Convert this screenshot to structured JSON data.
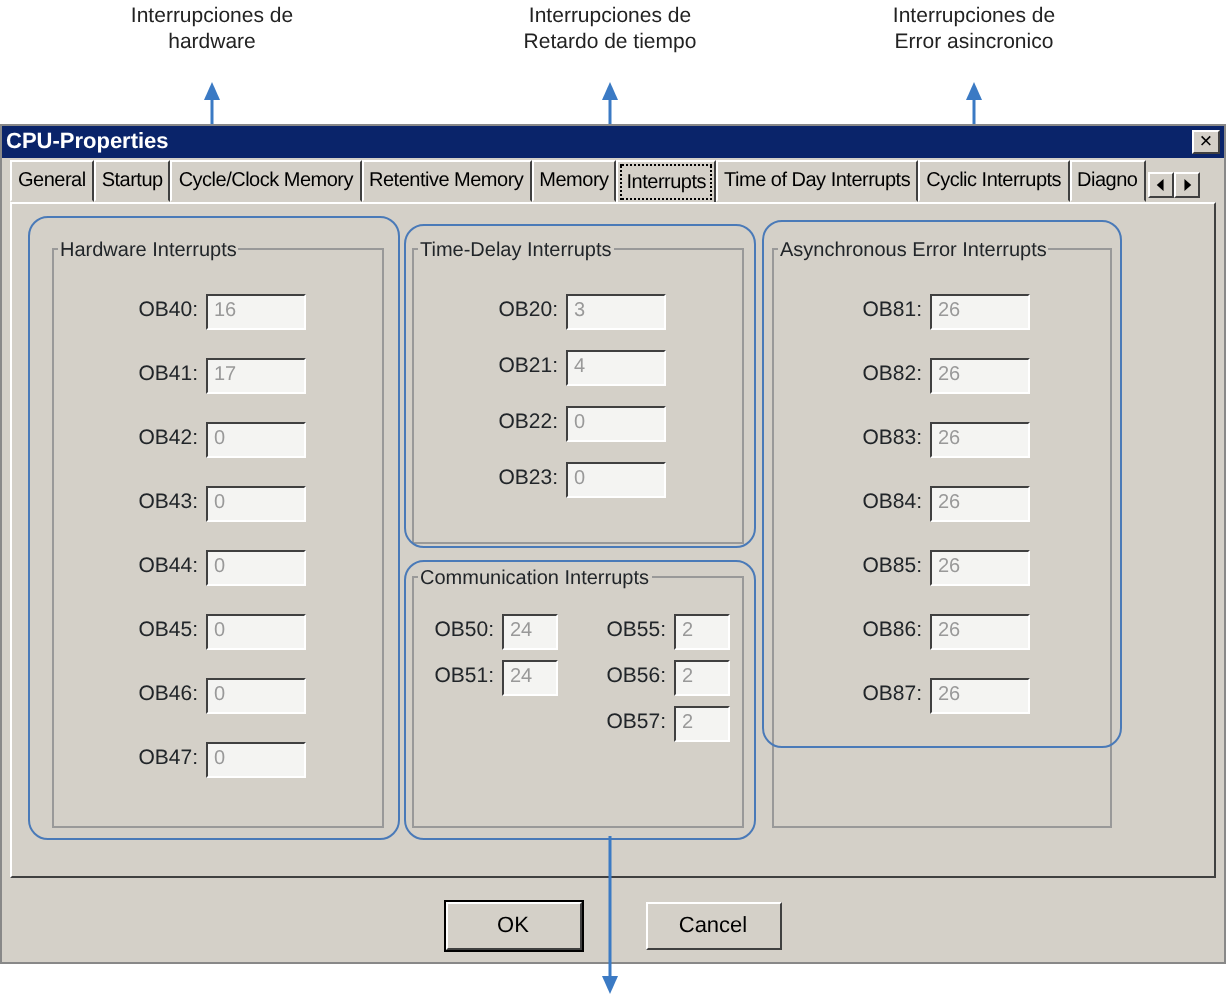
{
  "callouts": [
    {
      "kind": "up",
      "lines": [
        "Interrupciones de",
        "hardware"
      ]
    },
    {
      "kind": "up",
      "lines": [
        "Interrupciones de",
        "Retardo de tiempo"
      ]
    },
    {
      "kind": "up",
      "lines": [
        "Interrupciones de",
        "Error asincronico"
      ]
    },
    {
      "kind": "down"
    }
  ],
  "window": {
    "title": "CPU-Properties",
    "close": "×"
  },
  "tabs": [
    {
      "label": "General",
      "selected": false
    },
    {
      "label": "Startup",
      "selected": false
    },
    {
      "label": "Cycle/Clock Memory",
      "selected": false
    },
    {
      "label": "Retentive Memory",
      "selected": false
    },
    {
      "label": "Memory",
      "selected": false
    },
    {
      "label": "Interrupts",
      "selected": true
    },
    {
      "label": "Time of Day Interrupts",
      "selected": false
    },
    {
      "label": "Cyclic Interrupts",
      "selected": false
    },
    {
      "label": "Diagno",
      "selected": false
    }
  ],
  "groups": [
    {
      "title": "Hardware Interrupts",
      "columns": [
        [
          {
            "label": "OB40:",
            "value": "16"
          },
          {
            "label": "OB41:",
            "value": "17"
          },
          {
            "label": "OB42:",
            "value": "0"
          },
          {
            "label": "OB43:",
            "value": "0"
          },
          {
            "label": "OB44:",
            "value": "0"
          },
          {
            "label": "OB45:",
            "value": "0"
          },
          {
            "label": "OB46:",
            "value": "0"
          },
          {
            "label": "OB47:",
            "value": "0"
          }
        ]
      ]
    },
    {
      "title": "Time-Delay Interrupts",
      "columns": [
        [
          {
            "label": "OB20:",
            "value": "3"
          },
          {
            "label": "OB21:",
            "value": "4"
          },
          {
            "label": "OB22:",
            "value": "0"
          },
          {
            "label": "OB23:",
            "value": "0"
          }
        ]
      ]
    },
    {
      "title": "Communication Interrupts",
      "columns": [
        [
          {
            "label": "OB50:",
            "value": "24"
          },
          {
            "label": "OB51:",
            "value": "24"
          }
        ],
        [
          {
            "label": "OB55:",
            "value": "2"
          },
          {
            "label": "OB56:",
            "value": "2"
          },
          {
            "label": "OB57:",
            "value": "2"
          }
        ]
      ]
    },
    {
      "title": "Asynchronous Error Interrupts",
      "columns": [
        [
          {
            "label": "OB81:",
            "value": "26"
          },
          {
            "label": "OB82:",
            "value": "26"
          },
          {
            "label": "OB83:",
            "value": "26"
          },
          {
            "label": "OB84:",
            "value": "26"
          },
          {
            "label": "OB85:",
            "value": "26"
          },
          {
            "label": "OB86:",
            "value": "26"
          },
          {
            "label": "OB87:",
            "value": "26"
          }
        ]
      ]
    }
  ],
  "buttons": [
    {
      "label": "OK",
      "default": true
    },
    {
      "label": "Cancel",
      "default": false
    }
  ]
}
